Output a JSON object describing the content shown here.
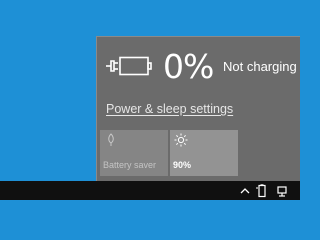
{
  "battery_flyout": {
    "percentage": "0%",
    "charge_status": "Not charging",
    "settings_link": "Power & sleep settings",
    "tiles": [
      {
        "label": "Battery saver",
        "icon": "battery-saver-icon",
        "enabled": false
      },
      {
        "label": "90%",
        "icon": "brightness-icon",
        "enabled": true
      }
    ]
  },
  "taskbar": {
    "tray_icons": [
      "chevron-up-icon",
      "battery-icon",
      "network-icon"
    ]
  },
  "colors": {
    "desktop": "#1e90d6",
    "flyout_bg": "#6b6b6b",
    "tile_disabled": "#858585",
    "tile_active": "#939393",
    "taskbar": "#101010"
  }
}
